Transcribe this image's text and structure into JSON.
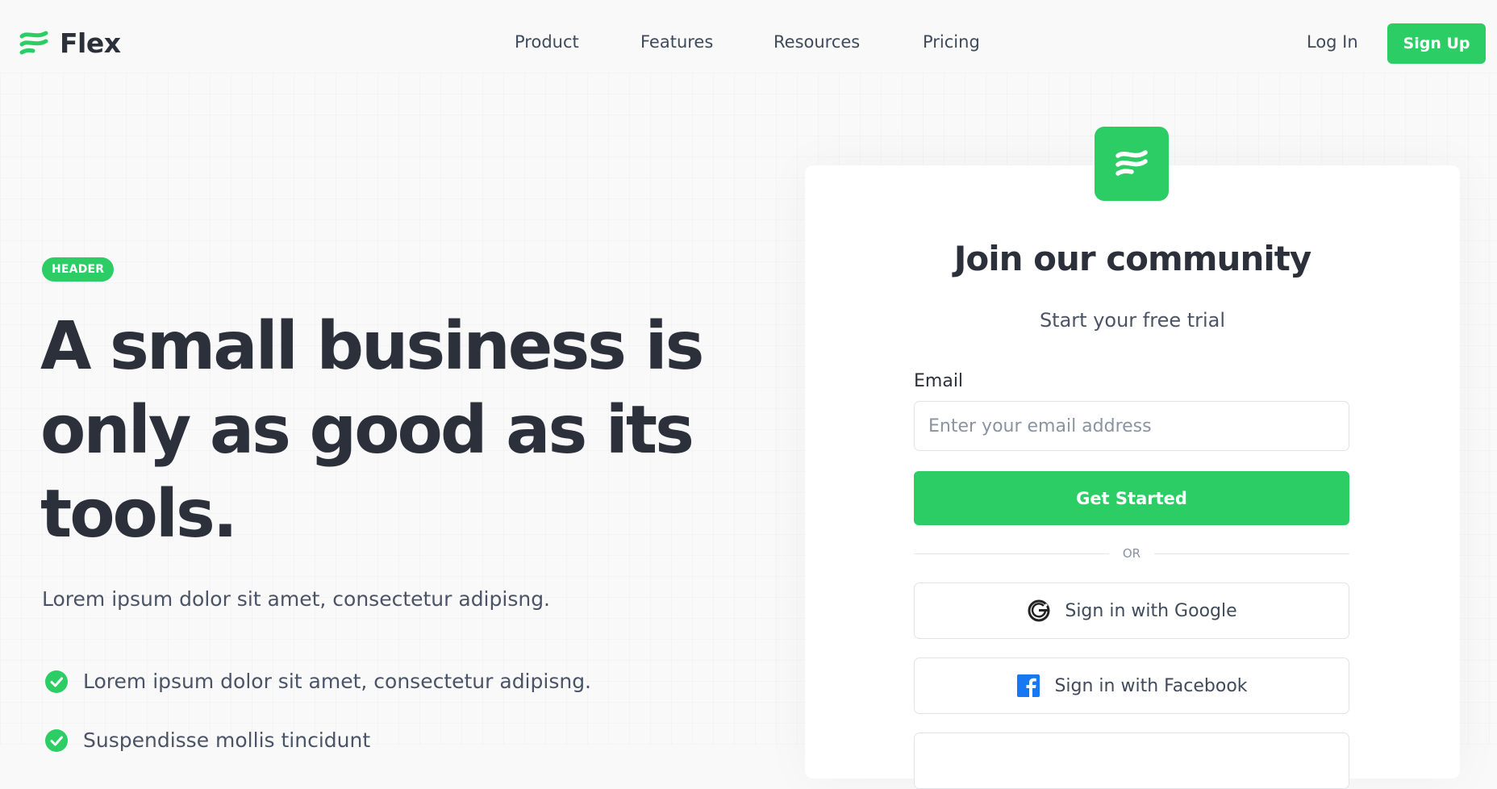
{
  "brand": {
    "name": "Flex",
    "accent": "#2dcd65",
    "text_dark": "#2b303b"
  },
  "nav": {
    "links": [
      "Product",
      "Features",
      "Resources",
      "Pricing"
    ],
    "login": "Log In",
    "signup": "Sign Up"
  },
  "hero": {
    "badge": "HEADER",
    "headline_lines": [
      "A small business is",
      "only as good as its",
      "tools."
    ],
    "lead": "Lorem ipsum dolor sit amet, consectetur adipisng.",
    "bullets": [
      "Lorem ipsum dolor sit amet, consectetur adipisng.",
      "Suspendisse mollis tincidunt"
    ]
  },
  "card": {
    "title": "Join our community",
    "subtitle": "Start your free trial",
    "email_label": "Email",
    "email_placeholder": "Enter your email address",
    "email_value": "",
    "cta": "Get Started",
    "divider": "OR",
    "google": "Sign in with Google",
    "facebook": "Sign in with Facebook"
  },
  "icons": {
    "logo": "flex-logo-icon",
    "app": "flex-app-icon",
    "check": "check-circle-icon",
    "google": "google-icon",
    "facebook": "facebook-icon"
  }
}
